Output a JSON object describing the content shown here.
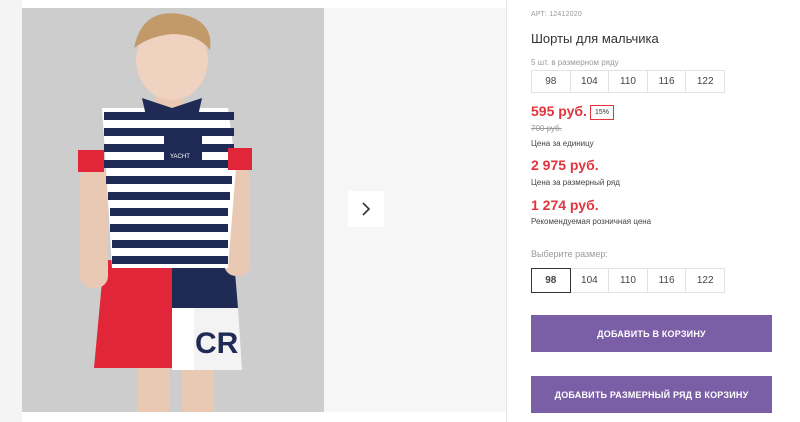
{
  "product": {
    "article": "АРТ: 12412020",
    "title": "Шорты для мальчика",
    "pack_label": "5 шт. в размерном ряду",
    "pack_sizes": [
      "98",
      "104",
      "110",
      "116",
      "122"
    ],
    "price_unit": "595 руб.",
    "discount": "15%",
    "old_price": "700 руб.",
    "price_unit_label": "Цена за единицу",
    "price_pack": "2 975 руб.",
    "price_pack_label": "Цена за размерный ряд",
    "price_retail": "1 274 руб.",
    "price_retail_label": "Рекомендуемая розничная цена",
    "choose_label": "Выберите размер:",
    "sizes": [
      "98",
      "104",
      "110",
      "116",
      "122"
    ],
    "selected_size": "98"
  },
  "actions": {
    "add_to_cart": "ДОБАВИТЬ В КОРЗИНУ",
    "add_pack_to_cart": "ДОБАВИТЬ РАЗМЕРНЫЙ РЯД В КОРЗИНУ"
  },
  "gallery": {
    "next_icon": "chevron-right-icon",
    "photo_text": "YACHT"
  },
  "colors": {
    "accent": "#7b5fa6",
    "price": "#e2343d",
    "navy": "#1f2a55"
  }
}
